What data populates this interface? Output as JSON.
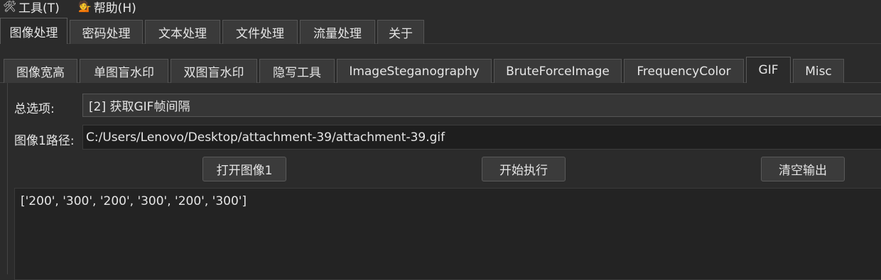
{
  "menubar": {
    "items": [
      {
        "label": "工具(T)",
        "icon": "tools-icon"
      },
      {
        "label": "帮助(H)",
        "icon": "help-person-icon"
      }
    ]
  },
  "top_tabs": [
    "图像处理",
    "密码处理",
    "文本处理",
    "文件处理",
    "流量处理",
    "关于"
  ],
  "top_tabs_active": "图像处理",
  "sub_tabs": [
    "图像宽高",
    "单图盲水印",
    "双图盲水印",
    "隐写工具",
    "ImageSteganography",
    "BruteForceImage",
    "FrequencyColor",
    "GIF",
    "Misc"
  ],
  "sub_tabs_active": "GIF",
  "form": {
    "option_label": "总选项:",
    "option_value": "[2] 获取GIF帧间隔",
    "path_label": "图像1路径:",
    "path_value": "C:/Users/Lenovo/Desktop/attachment-39/attachment-39.gif"
  },
  "buttons": {
    "open": "打开图像1",
    "run": "开始执行",
    "clear": "清空输出"
  },
  "output_text": "['200', '300', '200', '300', '200', '300']"
}
